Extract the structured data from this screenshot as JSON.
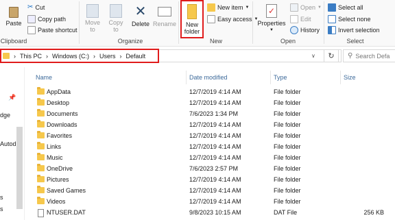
{
  "ribbon": {
    "clipboard": {
      "paste": "Paste",
      "cut": "Cut",
      "copy_path": "Copy path",
      "paste_shortcut": "Paste shortcut",
      "group": "Clipboard"
    },
    "organize": {
      "move_to": "Move",
      "move_to2": "to",
      "copy_to": "Copy",
      "copy_to2": "to",
      "delete": "Delete",
      "rename": "Rename",
      "group": "Organize"
    },
    "new": {
      "new_folder": "New",
      "new_folder2": "folder",
      "new_item": "New item",
      "easy_access": "Easy access",
      "group": "New"
    },
    "open": {
      "properties": "Properties",
      "open": "Open",
      "edit": "Edit",
      "history": "History",
      "group": "Open"
    },
    "select": {
      "select_all": "Select all",
      "select_none": "Select none",
      "invert": "Invert selection",
      "group": "Select"
    }
  },
  "address": {
    "crumbs": [
      "This PC",
      "Windows (C:)",
      "Users",
      "Default"
    ],
    "search_placeholder": "Search Defa"
  },
  "nav": [
    "dge",
    "Autod",
    "s",
    "s"
  ],
  "columns": {
    "name": "Name",
    "date": "Date modified",
    "type": "Type",
    "size": "Size"
  },
  "files": [
    {
      "name": "AppData",
      "date": "12/7/2019 4:14 AM",
      "type": "File folder",
      "size": "",
      "kind": "folder"
    },
    {
      "name": "Desktop",
      "date": "12/7/2019 4:14 AM",
      "type": "File folder",
      "size": "",
      "kind": "folder"
    },
    {
      "name": "Documents",
      "date": "7/6/2023 1:34 PM",
      "type": "File folder",
      "size": "",
      "kind": "folder"
    },
    {
      "name": "Downloads",
      "date": "12/7/2019 4:14 AM",
      "type": "File folder",
      "size": "",
      "kind": "folder"
    },
    {
      "name": "Favorites",
      "date": "12/7/2019 4:14 AM",
      "type": "File folder",
      "size": "",
      "kind": "folder"
    },
    {
      "name": "Links",
      "date": "12/7/2019 4:14 AM",
      "type": "File folder",
      "size": "",
      "kind": "folder"
    },
    {
      "name": "Music",
      "date": "12/7/2019 4:14 AM",
      "type": "File folder",
      "size": "",
      "kind": "folder"
    },
    {
      "name": "OneDrive",
      "date": "7/6/2023 2:57 PM",
      "type": "File folder",
      "size": "",
      "kind": "folder"
    },
    {
      "name": "Pictures",
      "date": "12/7/2019 4:14 AM",
      "type": "File folder",
      "size": "",
      "kind": "folder"
    },
    {
      "name": "Saved Games",
      "date": "12/7/2019 4:14 AM",
      "type": "File folder",
      "size": "",
      "kind": "folder"
    },
    {
      "name": "Videos",
      "date": "12/7/2019 4:14 AM",
      "type": "File folder",
      "size": "",
      "kind": "folder"
    },
    {
      "name": "NTUSER.DAT",
      "date": "9/8/2023 10:15 AM",
      "type": "DAT File",
      "size": "256 KB",
      "kind": "file"
    }
  ],
  "colors": {
    "highlight": "#e01b1b",
    "folder": "#f6c84c",
    "header_text": "#3d6a9a"
  }
}
